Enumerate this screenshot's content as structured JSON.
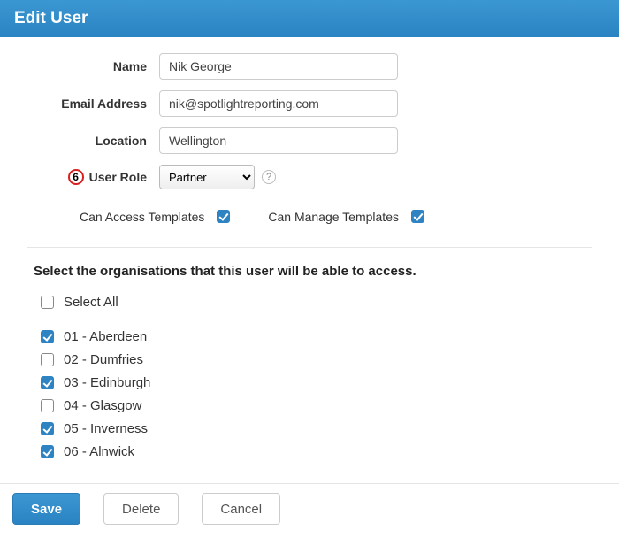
{
  "header": {
    "title": "Edit User"
  },
  "form": {
    "name_label": "Name",
    "name_value": "Nik George",
    "email_label": "Email Address",
    "email_value": "nik@spotlightreporting.com",
    "location_label": "Location",
    "location_value": "Wellington",
    "role_badge": "6",
    "role_label": "User Role",
    "role_value": "Partner",
    "help_symbol": "?",
    "perm_access_label": "Can Access Templates",
    "perm_access_checked": true,
    "perm_manage_label": "Can Manage Templates",
    "perm_manage_checked": true
  },
  "orgs": {
    "heading": "Select the organisations that this user will be able to access.",
    "select_all_label": "Select All",
    "select_all_checked": false,
    "items": [
      {
        "label": "01 - Aberdeen",
        "checked": true
      },
      {
        "label": "02 - Dumfries",
        "checked": false
      },
      {
        "label": "03 - Edinburgh",
        "checked": true
      },
      {
        "label": "04 - Glasgow",
        "checked": false
      },
      {
        "label": "05 - Inverness",
        "checked": true
      },
      {
        "label": "06 - Alnwick",
        "checked": true
      }
    ]
  },
  "footer": {
    "save_label": "Save",
    "delete_label": "Delete",
    "cancel_label": "Cancel"
  }
}
